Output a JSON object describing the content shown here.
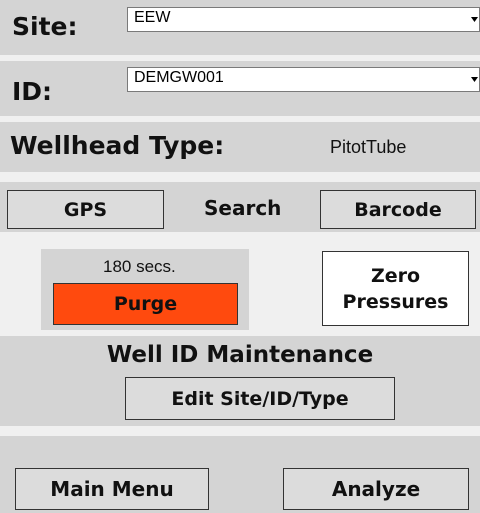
{
  "site": {
    "label": "Site:",
    "value": "EEW"
  },
  "id": {
    "label": "ID:",
    "value": "DEMGW001"
  },
  "wellhead": {
    "label": "Wellhead Type:",
    "value": "PitotTube"
  },
  "locate": {
    "gps_label": "GPS",
    "search_label": "Search",
    "barcode_label": "Barcode"
  },
  "purge": {
    "timer_text": "180 secs.",
    "button_label": "Purge",
    "color": "#ff4a0e"
  },
  "zero_pressures": {
    "line1": "Zero",
    "line2": "Pressures"
  },
  "maintenance": {
    "title": "Well ID Maintenance",
    "edit_label": "Edit Site/ID/Type"
  },
  "footer": {
    "main_menu_label": "Main Menu",
    "analyze_label": "Analyze"
  },
  "colors": {
    "band": "#d4d4d4",
    "background": "#f0f0f0",
    "accent": "#ff4a0e"
  },
  "icons": {
    "dropdown": "chevron-down-icon"
  }
}
